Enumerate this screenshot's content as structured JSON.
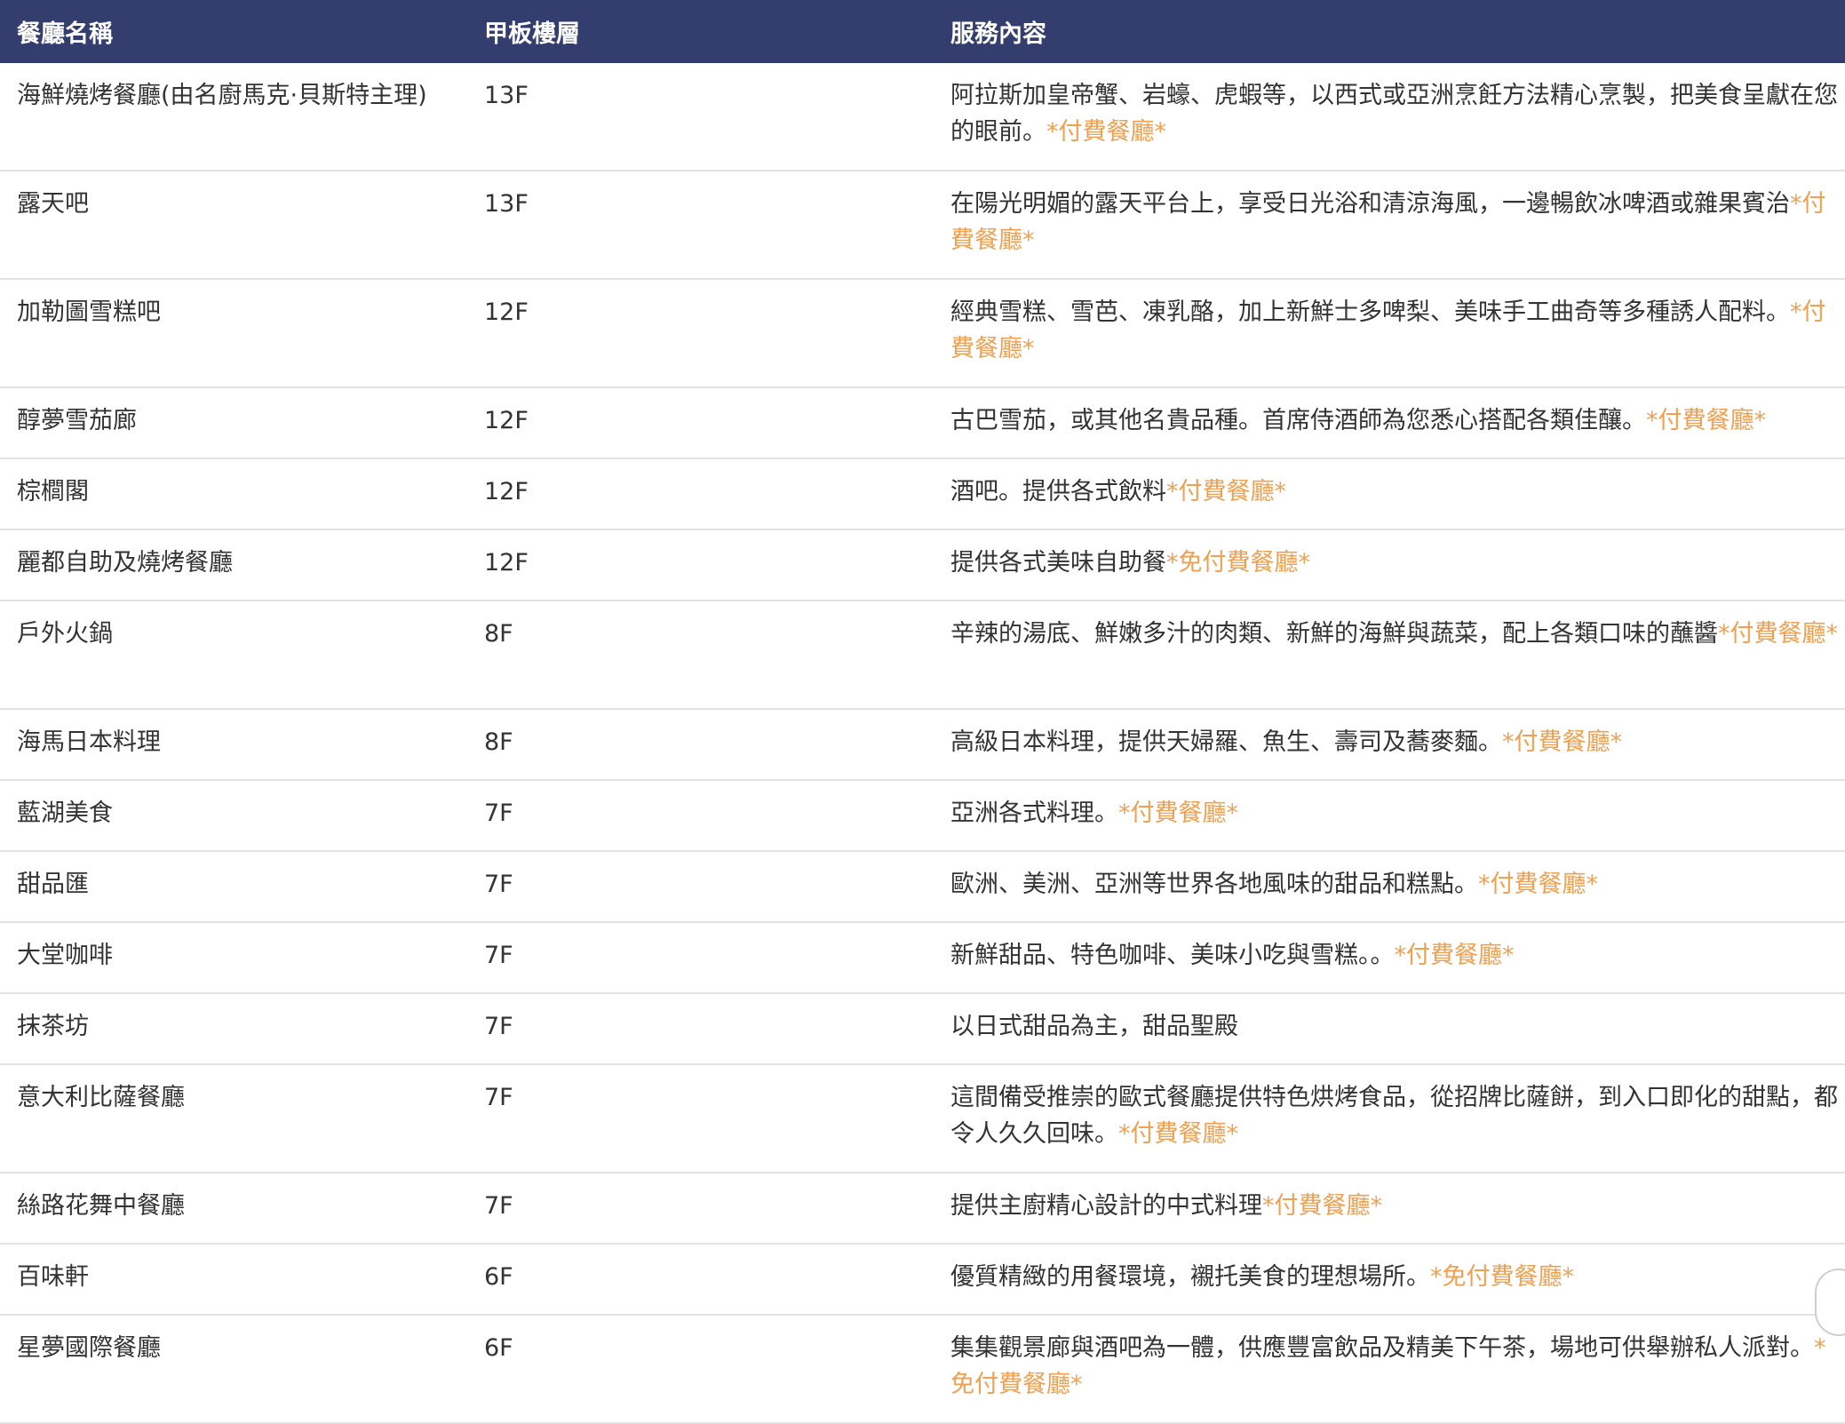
{
  "table": {
    "headers": {
      "name": "餐廳名稱",
      "deck": "甲板樓層",
      "service": "服務內容"
    },
    "accent_color": "#343e6e",
    "tag_color": "#f0a050",
    "rows": [
      {
        "name": "海鮮燒烤餐廳(由名廚馬克·貝斯特主理)",
        "deck": "13F",
        "service": "阿拉斯加皇帝蟹、岩蠔、虎蝦等，以西式或亞洲烹飪方法精心烹製，把美食呈獻在您的眼前。",
        "tag": "*付費餐廳*"
      },
      {
        "name": "露天吧",
        "deck": "13F",
        "service": "在陽光明媚的露天平台上，享受日光浴和清涼海風，一邊暢飲冰啤酒或雜果賓治",
        "tag": "*付費餐廳*"
      },
      {
        "name": "加勒圖雪糕吧",
        "deck": "12F",
        "service": "經典雪糕、雪芭、凍乳酪，加上新鮮士多啤梨、美味手工曲奇等多種誘人配料。",
        "tag": "*付費餐廳*"
      },
      {
        "name": "醇夢雪茄廊",
        "deck": "12F",
        "service": "古巴雪茄，或其他名貴品種。首席侍酒師為您悉心搭配各類佳釀。",
        "tag": "*付費餐廳*"
      },
      {
        "name": "棕櫚閣",
        "deck": "12F",
        "service": "酒吧。提供各式飲料",
        "tag": "*付費餐廳*"
      },
      {
        "name": "麗都自助及燒烤餐廳",
        "deck": "12F",
        "service": "提供各式美味自助餐",
        "tag": "*免付費餐廳*"
      },
      {
        "name": "戶外火鍋",
        "deck": "8F",
        "service": "辛辣的湯底、鮮嫩多汁的肉類、新鮮的海鮮與蔬菜，配上各類口味的蘸醬",
        "tag": "*付費餐廳*"
      },
      {
        "name": "海馬日本料理",
        "deck": "8F",
        "service": "高級日本料理，提供天婦羅、魚生、壽司及蕎麥麵。",
        "tag": "*付費餐廳*"
      },
      {
        "name": "藍湖美食",
        "deck": "7F",
        "service": "亞洲各式料理。",
        "tag": "*付費餐廳*"
      },
      {
        "name": "甜品匯",
        "deck": "7F",
        "service": "歐洲、美洲、亞洲等世界各地風味的甜品和糕點。",
        "tag": "*付費餐廳*"
      },
      {
        "name": "大堂咖啡",
        "deck": "7F",
        "service": "新鮮甜品、特色咖啡、美味小吃與雪糕。。",
        "tag": "*付費餐廳*"
      },
      {
        "name": "抹茶坊",
        "deck": "7F",
        "service": "以日式甜品為主，甜品聖殿",
        "tag": ""
      },
      {
        "name": "意大利比薩餐廳",
        "deck": "7F",
        "service": "這間備受推崇的歐式餐廳提供特色烘烤食品，從招牌比薩餅，到入口即化的甜點，都令人久久回味。",
        "tag": "*付費餐廳*"
      },
      {
        "name": "絲路花舞中餐廳",
        "deck": "7F",
        "service": "提供主廚精心設計的中式料理",
        "tag": "*付費餐廳*"
      },
      {
        "name": "百味軒",
        "deck": "6F",
        "service": "優質精緻的用餐環境，襯托美食的理想場所。",
        "tag": "*免付費餐廳*"
      },
      {
        "name": "星夢國際餐廳",
        "deck": "6F",
        "service": "集集觀景廊與酒吧為一體，供應豐富飲品及精美下午茶，場地可供舉辦私人派對。",
        "tag": "*免付費餐廳*"
      }
    ]
  }
}
